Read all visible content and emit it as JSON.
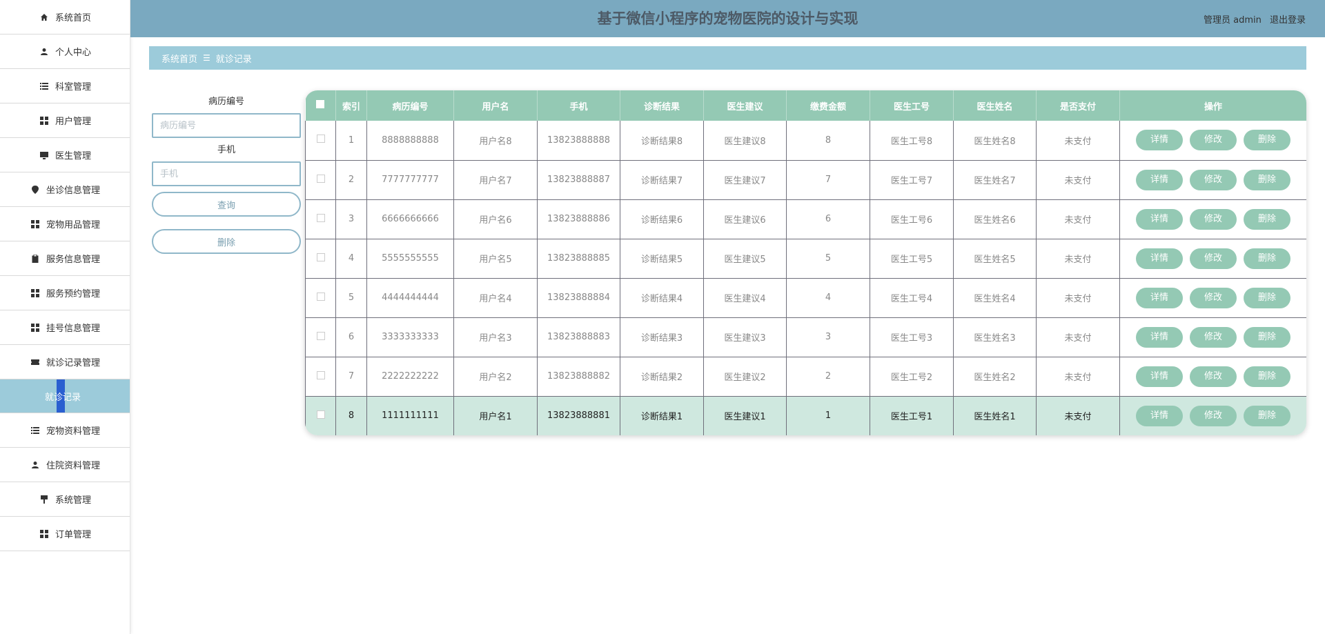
{
  "sidebar": {
    "items": [
      {
        "label": "系统首页",
        "icon": "home-icon"
      },
      {
        "label": "个人中心",
        "icon": "user-icon"
      },
      {
        "label": "科室管理",
        "icon": "list-icon"
      },
      {
        "label": "用户管理",
        "icon": "grid-icon"
      },
      {
        "label": "医生管理",
        "icon": "monitor-icon"
      },
      {
        "label": "坐诊信息管理",
        "icon": "location-icon"
      },
      {
        "label": "宠物用品管理",
        "icon": "grid-icon"
      },
      {
        "label": "服务信息管理",
        "icon": "clipboard-icon"
      },
      {
        "label": "服务预约管理",
        "icon": "grid-icon"
      },
      {
        "label": "挂号信息管理",
        "icon": "grid-icon"
      },
      {
        "label": "就诊记录管理",
        "icon": "ticket-icon"
      }
    ],
    "active_sub": "就诊记录",
    "items_after": [
      {
        "label": "宠物资料管理",
        "icon": "list-icon"
      },
      {
        "label": "住院资料管理",
        "icon": "user-icon"
      },
      {
        "label": "系统管理",
        "icon": "pin-icon"
      },
      {
        "label": "订单管理",
        "icon": "grid-icon"
      }
    ]
  },
  "header": {
    "title": "基于微信小程序的宠物医院的设计与实现",
    "user": "管理员 admin",
    "logout": "退出登录"
  },
  "breadcrumb": {
    "home": "系统首页",
    "sep": "☰",
    "current": "就诊记录"
  },
  "search": {
    "label1": "病历编号",
    "placeholder1": "病历编号",
    "label2": "手机",
    "placeholder2": "手机",
    "query": "查询",
    "delete": "删除"
  },
  "table": {
    "headers": [
      "索引",
      "病历编号",
      "用户名",
      "手机",
      "诊断结果",
      "医生建议",
      "缴费金额",
      "医生工号",
      "医生姓名",
      "是否支付",
      "操作"
    ],
    "actions": [
      "详情",
      "修改",
      "删除"
    ],
    "rows": [
      [
        "1",
        "8888888888",
        "用户名8",
        "13823888888",
        "诊断结果8",
        "医生建议8",
        "8",
        "医生工号8",
        "医生姓名8",
        "未支付"
      ],
      [
        "2",
        "7777777777",
        "用户名7",
        "13823888887",
        "诊断结果7",
        "医生建议7",
        "7",
        "医生工号7",
        "医生姓名7",
        "未支付"
      ],
      [
        "3",
        "6666666666",
        "用户名6",
        "13823888886",
        "诊断结果6",
        "医生建议6",
        "6",
        "医生工号6",
        "医生姓名6",
        "未支付"
      ],
      [
        "4",
        "5555555555",
        "用户名5",
        "13823888885",
        "诊断结果5",
        "医生建议5",
        "5",
        "医生工号5",
        "医生姓名5",
        "未支付"
      ],
      [
        "5",
        "4444444444",
        "用户名4",
        "13823888884",
        "诊断结果4",
        "医生建议4",
        "4",
        "医生工号4",
        "医生姓名4",
        "未支付"
      ],
      [
        "6",
        "3333333333",
        "用户名3",
        "13823888883",
        "诊断结果3",
        "医生建议3",
        "3",
        "医生工号3",
        "医生姓名3",
        "未支付"
      ],
      [
        "7",
        "2222222222",
        "用户名2",
        "13823888882",
        "诊断结果2",
        "医生建议2",
        "2",
        "医生工号2",
        "医生姓名2",
        "未支付"
      ],
      [
        "8",
        "1111111111",
        "用户名1",
        "13823888881",
        "诊断结果1",
        "医生建议1",
        "1",
        "医生工号1",
        "医生姓名1",
        "未支付"
      ]
    ]
  }
}
